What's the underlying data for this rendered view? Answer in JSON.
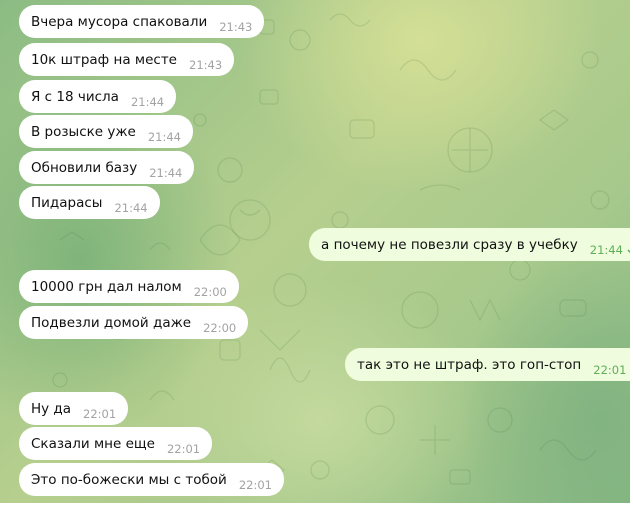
{
  "messages": [
    {
      "text": "Вчера мусора спаковали",
      "time": "21:43",
      "dir": "in"
    },
    {
      "text": "10к штраф на месте",
      "time": "21:43",
      "dir": "in"
    },
    {
      "text": "Я с 18 числа",
      "time": "21:44",
      "dir": "in"
    },
    {
      "text": "В розыске уже",
      "time": "21:44",
      "dir": "in"
    },
    {
      "text": "Обновили базу",
      "time": "21:44",
      "dir": "in"
    },
    {
      "text": "Пидарасы",
      "time": "21:44",
      "dir": "in"
    },
    {
      "text": "а почему не повезли сразу в учебку",
      "time": "21:44",
      "dir": "out",
      "status": "read"
    },
    {
      "text": "10000 грн дал налом",
      "time": "22:00",
      "dir": "in"
    },
    {
      "text": "Подвезли домой даже",
      "time": "22:00",
      "dir": "in"
    },
    {
      "text": "так это не штраф. это гоп-стоп",
      "time": "22:01",
      "dir": "out",
      "status": "read"
    },
    {
      "text": "Ну да",
      "time": "22:01",
      "dir": "in"
    },
    {
      "text": "Сказали мне еще",
      "time": "22:01",
      "dir": "in"
    },
    {
      "text": "Это по-божески мы с тобой",
      "time": "22:01",
      "dir": "in"
    }
  ],
  "colors": {
    "incoming_bubble": "#ffffff",
    "outgoing_bubble": "#effdde",
    "outgoing_time": "#5fae57",
    "read_checkmark": "#5fae57",
    "incoming_time": "#a3a3a3"
  },
  "icons": {
    "read_status": "double-check-icon"
  }
}
